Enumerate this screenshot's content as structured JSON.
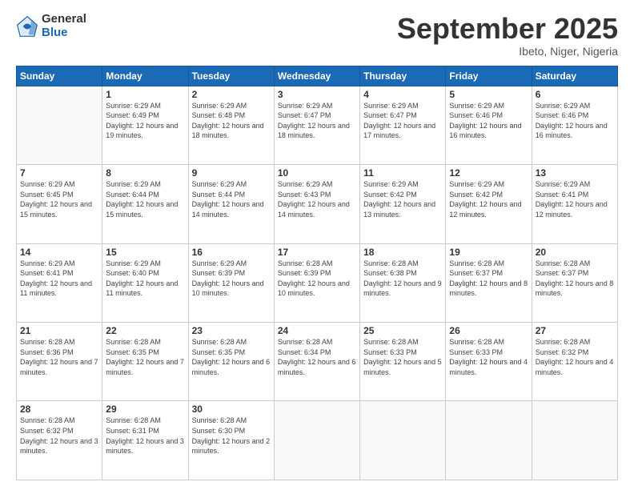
{
  "logo": {
    "general": "General",
    "blue": "Blue"
  },
  "header": {
    "month": "September 2025",
    "location": "Ibeto, Niger, Nigeria"
  },
  "days": [
    "Sunday",
    "Monday",
    "Tuesday",
    "Wednesday",
    "Thursday",
    "Friday",
    "Saturday"
  ],
  "weeks": [
    [
      {
        "day": "",
        "info": ""
      },
      {
        "day": "1",
        "info": "Sunrise: 6:29 AM\nSunset: 6:49 PM\nDaylight: 12 hours\nand 19 minutes."
      },
      {
        "day": "2",
        "info": "Sunrise: 6:29 AM\nSunset: 6:48 PM\nDaylight: 12 hours\nand 18 minutes."
      },
      {
        "day": "3",
        "info": "Sunrise: 6:29 AM\nSunset: 6:47 PM\nDaylight: 12 hours\nand 18 minutes."
      },
      {
        "day": "4",
        "info": "Sunrise: 6:29 AM\nSunset: 6:47 PM\nDaylight: 12 hours\nand 17 minutes."
      },
      {
        "day": "5",
        "info": "Sunrise: 6:29 AM\nSunset: 6:46 PM\nDaylight: 12 hours\nand 16 minutes."
      },
      {
        "day": "6",
        "info": "Sunrise: 6:29 AM\nSunset: 6:46 PM\nDaylight: 12 hours\nand 16 minutes."
      }
    ],
    [
      {
        "day": "7",
        "info": "Sunrise: 6:29 AM\nSunset: 6:45 PM\nDaylight: 12 hours\nand 15 minutes."
      },
      {
        "day": "8",
        "info": "Sunrise: 6:29 AM\nSunset: 6:44 PM\nDaylight: 12 hours\nand 15 minutes."
      },
      {
        "day": "9",
        "info": "Sunrise: 6:29 AM\nSunset: 6:44 PM\nDaylight: 12 hours\nand 14 minutes."
      },
      {
        "day": "10",
        "info": "Sunrise: 6:29 AM\nSunset: 6:43 PM\nDaylight: 12 hours\nand 14 minutes."
      },
      {
        "day": "11",
        "info": "Sunrise: 6:29 AM\nSunset: 6:42 PM\nDaylight: 12 hours\nand 13 minutes."
      },
      {
        "day": "12",
        "info": "Sunrise: 6:29 AM\nSunset: 6:42 PM\nDaylight: 12 hours\nand 12 minutes."
      },
      {
        "day": "13",
        "info": "Sunrise: 6:29 AM\nSunset: 6:41 PM\nDaylight: 12 hours\nand 12 minutes."
      }
    ],
    [
      {
        "day": "14",
        "info": "Sunrise: 6:29 AM\nSunset: 6:41 PM\nDaylight: 12 hours\nand 11 minutes."
      },
      {
        "day": "15",
        "info": "Sunrise: 6:29 AM\nSunset: 6:40 PM\nDaylight: 12 hours\nand 11 minutes."
      },
      {
        "day": "16",
        "info": "Sunrise: 6:29 AM\nSunset: 6:39 PM\nDaylight: 12 hours\nand 10 minutes."
      },
      {
        "day": "17",
        "info": "Sunrise: 6:28 AM\nSunset: 6:39 PM\nDaylight: 12 hours\nand 10 minutes."
      },
      {
        "day": "18",
        "info": "Sunrise: 6:28 AM\nSunset: 6:38 PM\nDaylight: 12 hours\nand 9 minutes."
      },
      {
        "day": "19",
        "info": "Sunrise: 6:28 AM\nSunset: 6:37 PM\nDaylight: 12 hours\nand 8 minutes."
      },
      {
        "day": "20",
        "info": "Sunrise: 6:28 AM\nSunset: 6:37 PM\nDaylight: 12 hours\nand 8 minutes."
      }
    ],
    [
      {
        "day": "21",
        "info": "Sunrise: 6:28 AM\nSunset: 6:36 PM\nDaylight: 12 hours\nand 7 minutes."
      },
      {
        "day": "22",
        "info": "Sunrise: 6:28 AM\nSunset: 6:35 PM\nDaylight: 12 hours\nand 7 minutes."
      },
      {
        "day": "23",
        "info": "Sunrise: 6:28 AM\nSunset: 6:35 PM\nDaylight: 12 hours\nand 6 minutes."
      },
      {
        "day": "24",
        "info": "Sunrise: 6:28 AM\nSunset: 6:34 PM\nDaylight: 12 hours\nand 6 minutes."
      },
      {
        "day": "25",
        "info": "Sunrise: 6:28 AM\nSunset: 6:33 PM\nDaylight: 12 hours\nand 5 minutes."
      },
      {
        "day": "26",
        "info": "Sunrise: 6:28 AM\nSunset: 6:33 PM\nDaylight: 12 hours\nand 4 minutes."
      },
      {
        "day": "27",
        "info": "Sunrise: 6:28 AM\nSunset: 6:32 PM\nDaylight: 12 hours\nand 4 minutes."
      }
    ],
    [
      {
        "day": "28",
        "info": "Sunrise: 6:28 AM\nSunset: 6:32 PM\nDaylight: 12 hours\nand 3 minutes."
      },
      {
        "day": "29",
        "info": "Sunrise: 6:28 AM\nSunset: 6:31 PM\nDaylight: 12 hours\nand 3 minutes."
      },
      {
        "day": "30",
        "info": "Sunrise: 6:28 AM\nSunset: 6:30 PM\nDaylight: 12 hours\nand 2 minutes."
      },
      {
        "day": "",
        "info": ""
      },
      {
        "day": "",
        "info": ""
      },
      {
        "day": "",
        "info": ""
      },
      {
        "day": "",
        "info": ""
      }
    ]
  ]
}
